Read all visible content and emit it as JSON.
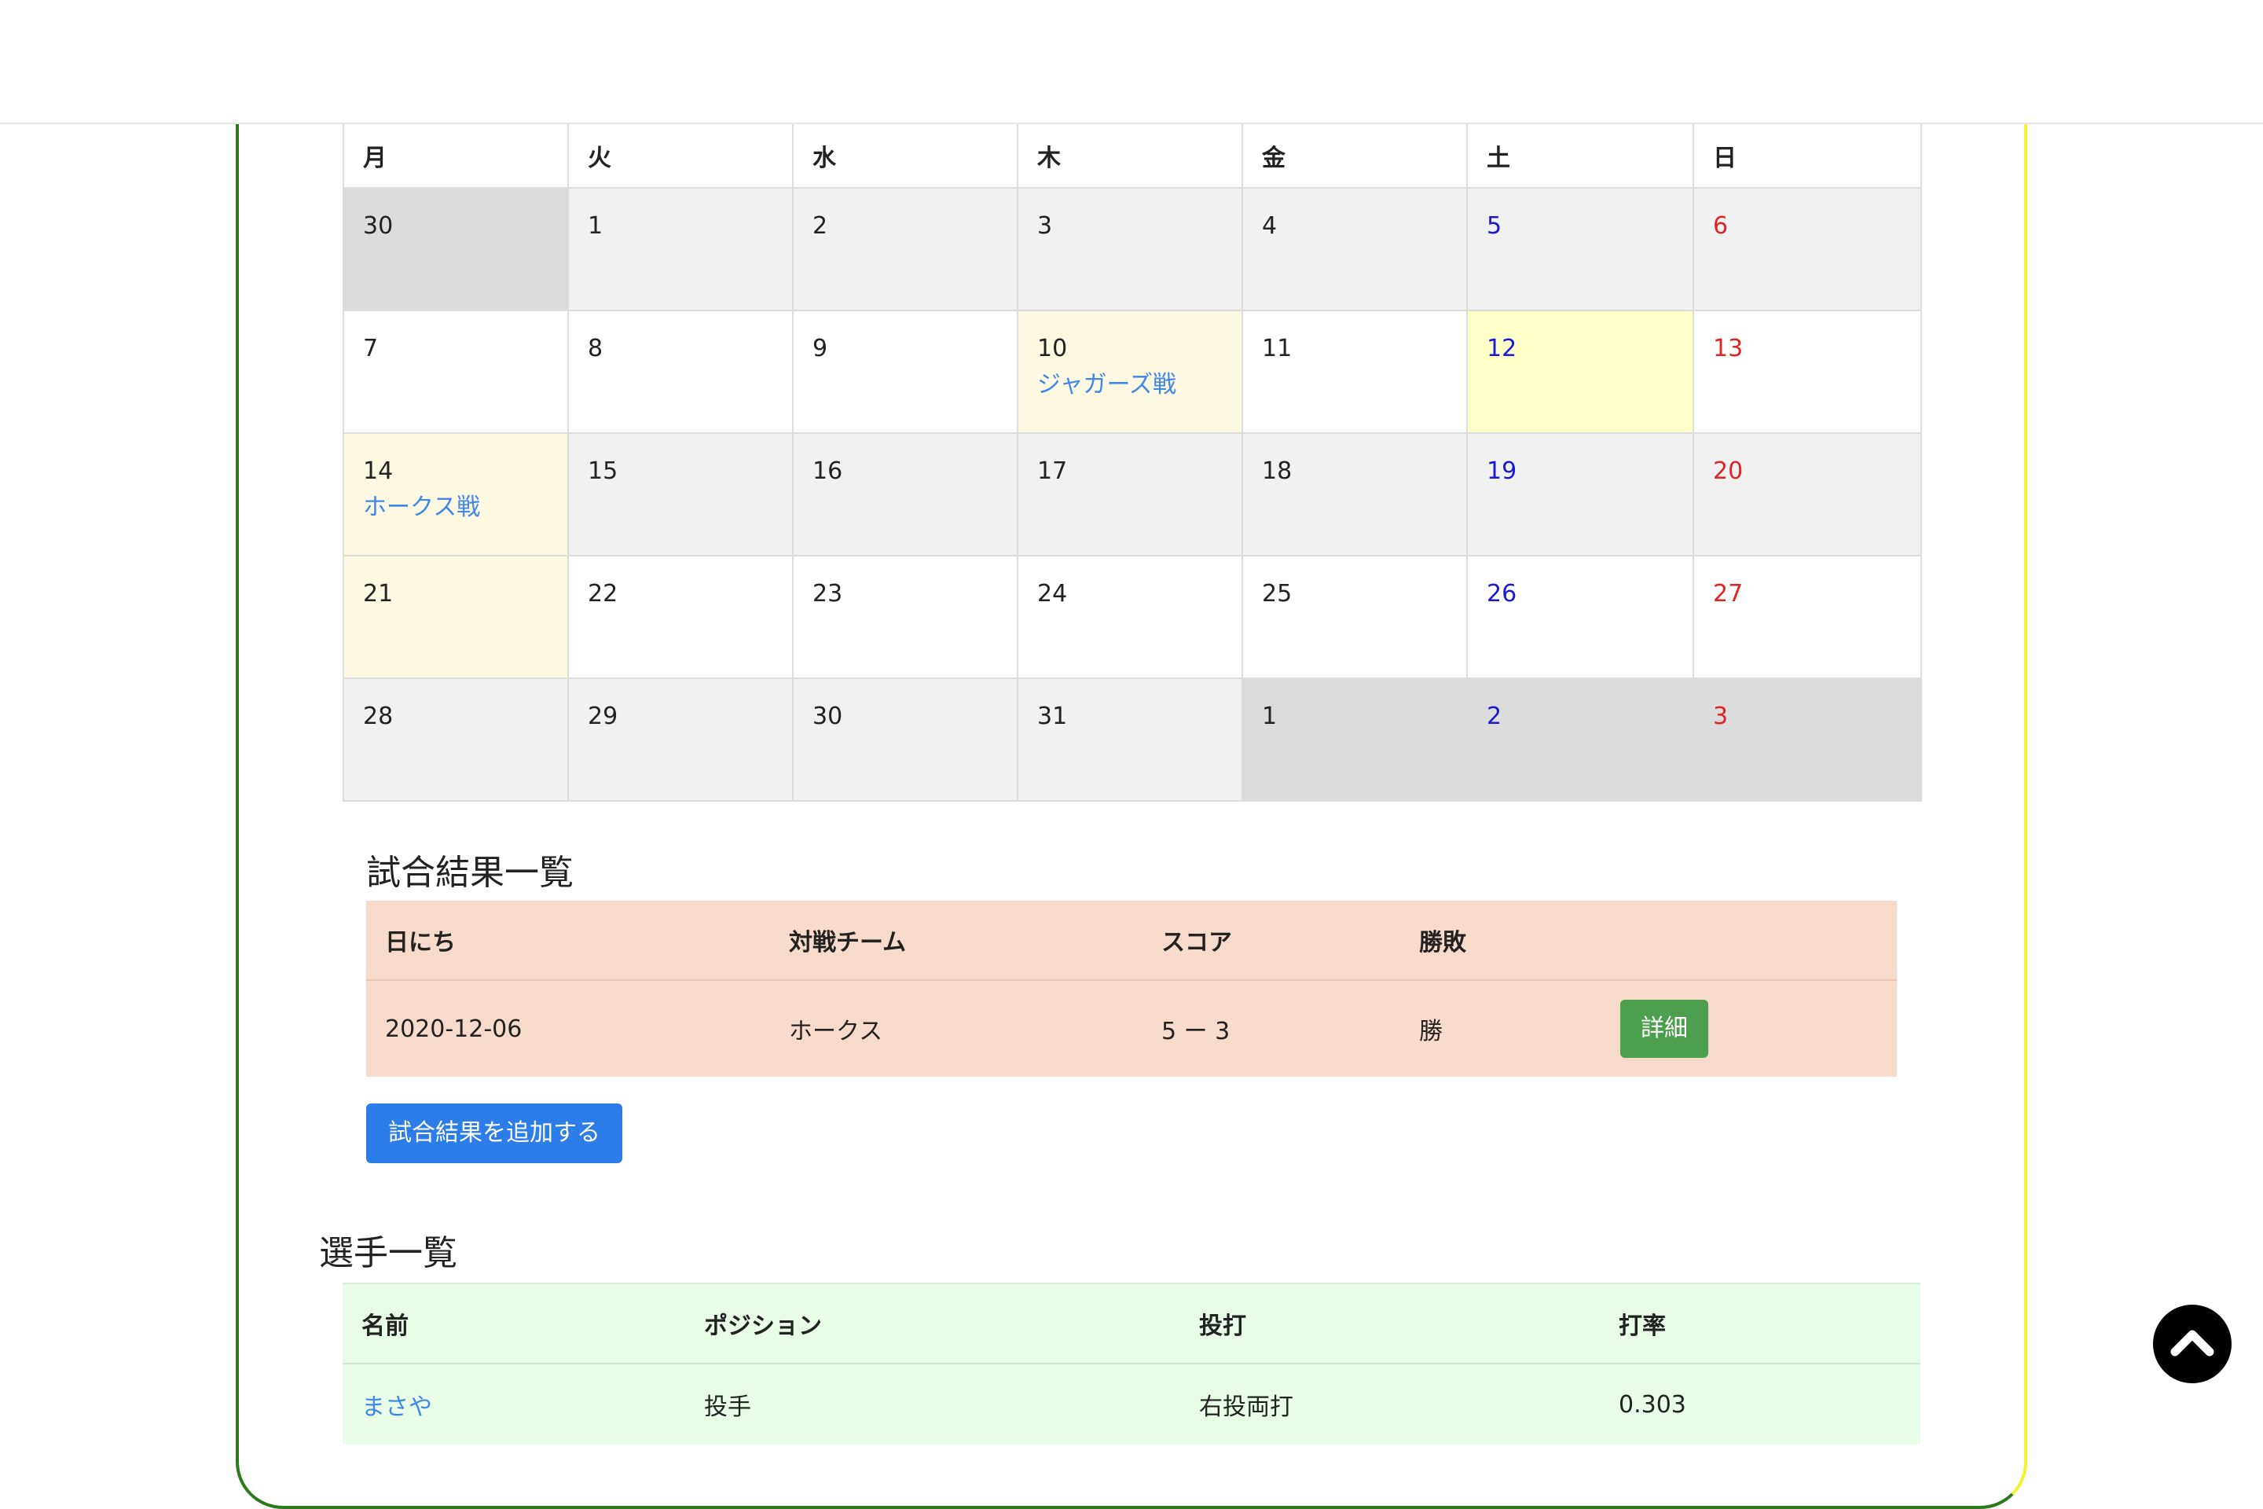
{
  "calendar": {
    "weekdays": [
      "月",
      "火",
      "水",
      "木",
      "金",
      "土",
      "日"
    ],
    "weeks": [
      [
        {
          "day": "30",
          "kind": "other"
        },
        {
          "day": "1"
        },
        {
          "day": "2"
        },
        {
          "day": "3"
        },
        {
          "day": "4"
        },
        {
          "day": "5",
          "color": "sat"
        },
        {
          "day": "6",
          "color": "sun"
        }
      ],
      [
        {
          "day": "7"
        },
        {
          "day": "8"
        },
        {
          "day": "9"
        },
        {
          "day": "10",
          "kind": "event",
          "event": "ジャガーズ戦"
        },
        {
          "day": "11"
        },
        {
          "day": "12",
          "color": "sat",
          "kind": "today"
        },
        {
          "day": "13",
          "color": "sun"
        }
      ],
      [
        {
          "day": "14",
          "kind": "event",
          "event": "ホークス戦"
        },
        {
          "day": "15"
        },
        {
          "day": "16"
        },
        {
          "day": "17"
        },
        {
          "day": "18"
        },
        {
          "day": "19",
          "color": "sat"
        },
        {
          "day": "20",
          "color": "sun"
        }
      ],
      [
        {
          "day": "21",
          "kind": "event"
        },
        {
          "day": "22"
        },
        {
          "day": "23"
        },
        {
          "day": "24"
        },
        {
          "day": "25"
        },
        {
          "day": "26",
          "color": "sat"
        },
        {
          "day": "27",
          "color": "sun"
        }
      ],
      [
        {
          "day": "28"
        },
        {
          "day": "29"
        },
        {
          "day": "30"
        },
        {
          "day": "31"
        },
        {
          "day": "1",
          "kind": "other"
        },
        {
          "day": "2",
          "color": "sat",
          "kind": "other"
        },
        {
          "day": "3",
          "color": "sun",
          "kind": "other"
        }
      ]
    ]
  },
  "results": {
    "title": "試合結果一覧",
    "headers": [
      "日にち",
      "対戦チーム",
      "スコア",
      "勝敗",
      ""
    ],
    "rows": [
      {
        "date": "2020-12-06",
        "opponent": "ホークス",
        "score": "5 ー 3",
        "result": "勝",
        "detail_label": "詳細"
      }
    ],
    "add_button_label": "試合結果を追加する"
  },
  "players": {
    "title": "選手一覧",
    "headers": [
      "名前",
      "ポジション",
      "投打",
      "打率"
    ],
    "rows": [
      {
        "name": "まさや",
        "position": "投手",
        "bats_throws": "右投両打",
        "avg": "0.303"
      }
    ]
  },
  "colors": {
    "accent_blue": "#2d7de8",
    "detail_green": "#4c9f4c",
    "saturday": "#1a1ad6",
    "sunday": "#e02424",
    "frame_green": "#2c7a1c",
    "frame_yellow": "#f4f232"
  },
  "icons": {
    "scroll_top": "chevron-up-icon"
  }
}
